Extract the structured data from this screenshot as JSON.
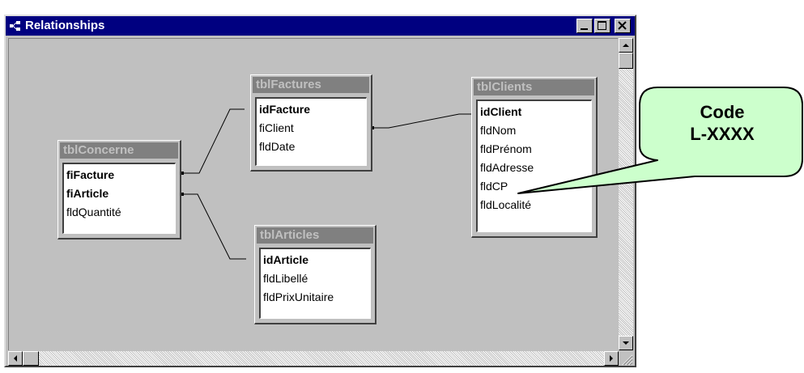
{
  "window": {
    "title": "Relationships",
    "buttons": {
      "minimize": "minimize-icon",
      "maximize": "maximize-icon",
      "close": "close-icon"
    }
  },
  "tables": [
    {
      "name": "tblConcerne",
      "fields": [
        {
          "name": "fiFacture",
          "key": true
        },
        {
          "name": "fiArticle",
          "key": true
        },
        {
          "name": "fldQuantité",
          "key": false
        }
      ]
    },
    {
      "name": "tblFactures",
      "fields": [
        {
          "name": "idFacture",
          "key": true
        },
        {
          "name": "fiClient",
          "key": false
        },
        {
          "name": "fldDate",
          "key": false
        }
      ]
    },
    {
      "name": "tblArticles",
      "fields": [
        {
          "name": "idArticle",
          "key": true
        },
        {
          "name": "fldLibellé",
          "key": false
        },
        {
          "name": "fldPrixUnitaire",
          "key": false
        }
      ]
    },
    {
      "name": "tblClients",
      "fields": [
        {
          "name": "idClient",
          "key": true
        },
        {
          "name": "fldNom",
          "key": false
        },
        {
          "name": "fldPrénom",
          "key": false
        },
        {
          "name": "fldAdresse",
          "key": false
        },
        {
          "name": "fldCP",
          "key": false
        },
        {
          "name": "fldLocalité",
          "key": false
        }
      ]
    }
  ],
  "callout": {
    "line1": "Code",
    "line2": "L-XXXX",
    "fill_color": "#ccffcc"
  },
  "colors": {
    "titlebar": "#000080",
    "table_title_bg": "#808080",
    "table_title_text": "#c0c0c0",
    "workspace": "#c0c0c0"
  }
}
